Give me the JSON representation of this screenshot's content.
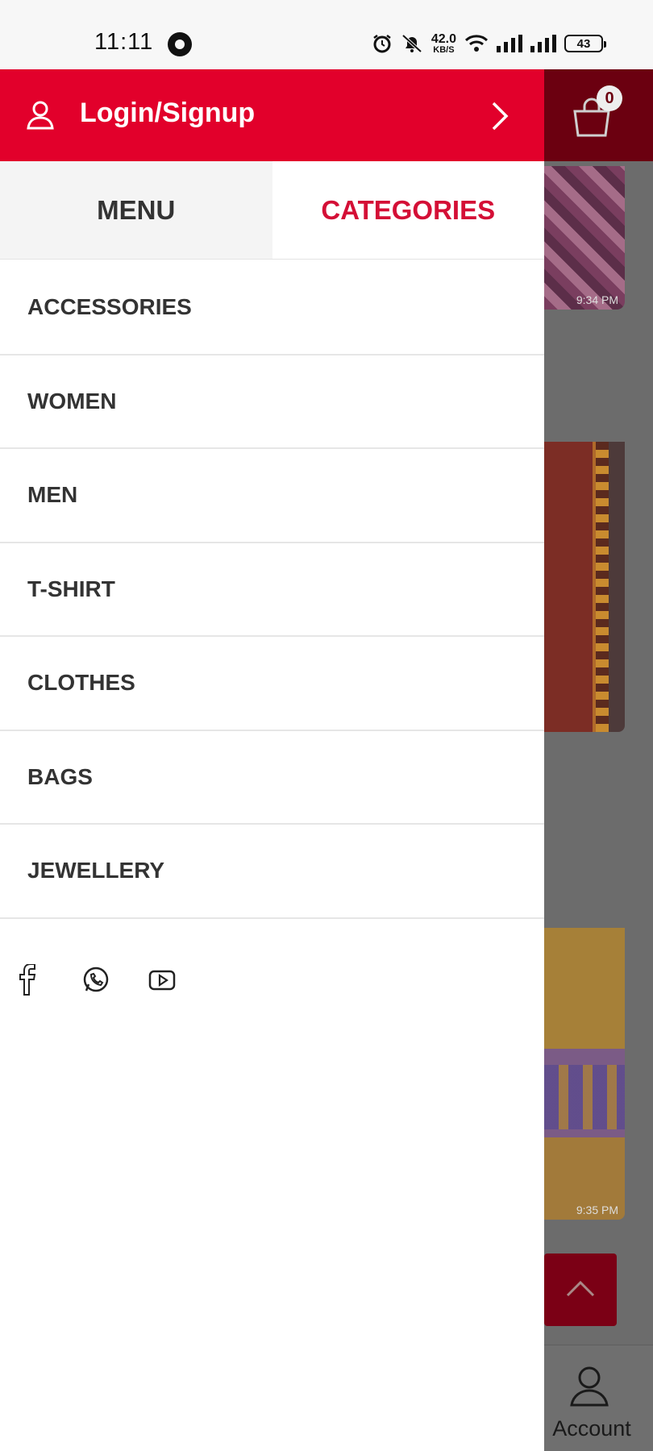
{
  "status_bar": {
    "time": "11:11",
    "net_speed": "42.0",
    "net_unit": "KB/S",
    "battery": "43"
  },
  "drawer": {
    "login_label": "Login/Signup",
    "tabs": [
      {
        "label": "MENU",
        "active": false
      },
      {
        "label": "CATEGORIES",
        "active": true
      }
    ],
    "categories": [
      "ACCESSORIES",
      "WOMEN",
      "MEN",
      "T-SHIRT",
      "CLOTHES",
      "BAGS",
      "JEWELLERY"
    ],
    "social_icons": [
      "facebook-icon",
      "whatsapp-icon",
      "youtube-icon"
    ]
  },
  "background": {
    "cart_count": "0",
    "thumb_times": [
      "9:34 PM",
      "9:35 PM"
    ],
    "account_label": "Account"
  },
  "colors": {
    "brand_red": "#e2002b",
    "active_tab_text": "#d40f36",
    "overlay_gray": "#6c6c6c"
  }
}
